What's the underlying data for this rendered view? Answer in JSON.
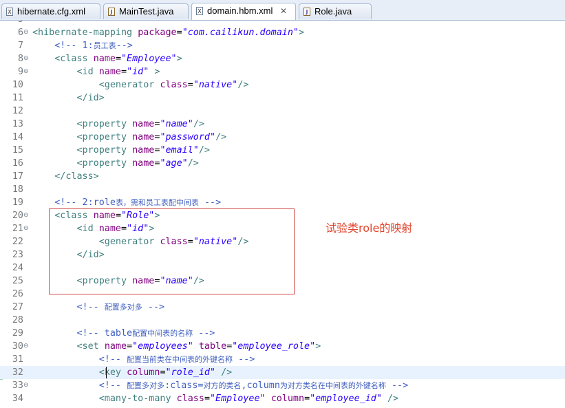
{
  "tabs": [
    {
      "label": "hibernate.cfg.xml",
      "icon": "xml-file-icon",
      "active": false
    },
    {
      "label": "MainTest.java",
      "icon": "java-file-icon",
      "active": false
    },
    {
      "label": "domain.hbm.xml",
      "icon": "xml-file-icon",
      "active": true,
      "close": "✕"
    },
    {
      "label": "Role.java",
      "icon": "java-file-icon",
      "active": false
    }
  ],
  "lines": [
    {
      "n": "5",
      "fold": "",
      "tokens": []
    },
    {
      "n": "6",
      "fold": "⊖",
      "tokens": [
        [
          "t",
          "<hibernate-mapping "
        ],
        [
          "a",
          "package"
        ],
        [
          "p",
          "="
        ],
        [
          "v",
          "\"com.cailikun.domain\""
        ],
        [
          "t",
          ">"
        ]
      ]
    },
    {
      "n": "7",
      "fold": "",
      "tokens": [
        [
          "p",
          "    "
        ],
        [
          "c",
          "<!-- 1:"
        ],
        [
          "cjk",
          "员工表"
        ],
        [
          "c",
          "-->"
        ]
      ]
    },
    {
      "n": "8",
      "fold": "⊖",
      "tokens": [
        [
          "p",
          "    "
        ],
        [
          "t",
          "<class "
        ],
        [
          "a",
          "name"
        ],
        [
          "p",
          "="
        ],
        [
          "v",
          "\"Employee\""
        ],
        [
          "t",
          ">"
        ]
      ]
    },
    {
      "n": "9",
      "fold": "⊖",
      "tokens": [
        [
          "p",
          "        "
        ],
        [
          "t",
          "<id "
        ],
        [
          "a",
          "name"
        ],
        [
          "p",
          "="
        ],
        [
          "v",
          "\"id\""
        ],
        [
          "t",
          " >"
        ]
      ]
    },
    {
      "n": "10",
      "fold": "",
      "tokens": [
        [
          "p",
          "            "
        ],
        [
          "t",
          "<generator "
        ],
        [
          "a",
          "class"
        ],
        [
          "p",
          "="
        ],
        [
          "v",
          "\"native\""
        ],
        [
          "t",
          "/>"
        ]
      ]
    },
    {
      "n": "11",
      "fold": "",
      "tokens": [
        [
          "p",
          "        "
        ],
        [
          "t",
          "</id>"
        ]
      ]
    },
    {
      "n": "12",
      "fold": "",
      "tokens": []
    },
    {
      "n": "13",
      "fold": "",
      "tokens": [
        [
          "p",
          "        "
        ],
        [
          "t",
          "<property "
        ],
        [
          "a",
          "name"
        ],
        [
          "p",
          "="
        ],
        [
          "v",
          "\"name\""
        ],
        [
          "t",
          "/>"
        ]
      ]
    },
    {
      "n": "14",
      "fold": "",
      "tokens": [
        [
          "p",
          "        "
        ],
        [
          "t",
          "<property "
        ],
        [
          "a",
          "name"
        ],
        [
          "p",
          "="
        ],
        [
          "v",
          "\"password\""
        ],
        [
          "t",
          "/>"
        ]
      ]
    },
    {
      "n": "15",
      "fold": "",
      "tokens": [
        [
          "p",
          "        "
        ],
        [
          "t",
          "<property "
        ],
        [
          "a",
          "name"
        ],
        [
          "p",
          "="
        ],
        [
          "v",
          "\"email\""
        ],
        [
          "t",
          "/>"
        ]
      ]
    },
    {
      "n": "16",
      "fold": "",
      "tokens": [
        [
          "p",
          "        "
        ],
        [
          "t",
          "<property "
        ],
        [
          "a",
          "name"
        ],
        [
          "p",
          "="
        ],
        [
          "v",
          "\"age\""
        ],
        [
          "t",
          "/>"
        ]
      ]
    },
    {
      "n": "17",
      "fold": "",
      "tokens": [
        [
          "p",
          "    "
        ],
        [
          "t",
          "</class>"
        ]
      ]
    },
    {
      "n": "18",
      "fold": "",
      "tokens": []
    },
    {
      "n": "19",
      "fold": "",
      "tokens": [
        [
          "p",
          "    "
        ],
        [
          "c",
          "<!-- 2:role"
        ],
        [
          "cjk",
          "表，需和员工表配中间表"
        ],
        [
          "c",
          " -->"
        ]
      ]
    },
    {
      "n": "20",
      "fold": "⊖",
      "tokens": [
        [
          "p",
          "    "
        ],
        [
          "t",
          "<class "
        ],
        [
          "a",
          "name"
        ],
        [
          "p",
          "="
        ],
        [
          "v",
          "\"Role\""
        ],
        [
          "t",
          ">"
        ]
      ]
    },
    {
      "n": "21",
      "fold": "⊖",
      "tokens": [
        [
          "p",
          "        "
        ],
        [
          "t",
          "<id "
        ],
        [
          "a",
          "name"
        ],
        [
          "p",
          "="
        ],
        [
          "v",
          "\"id\""
        ],
        [
          "t",
          ">"
        ]
      ]
    },
    {
      "n": "22",
      "fold": "",
      "tokens": [
        [
          "p",
          "            "
        ],
        [
          "t",
          "<generator "
        ],
        [
          "a",
          "class"
        ],
        [
          "p",
          "="
        ],
        [
          "v",
          "\"native\""
        ],
        [
          "t",
          "/>"
        ]
      ]
    },
    {
      "n": "23",
      "fold": "",
      "tokens": [
        [
          "p",
          "        "
        ],
        [
          "t",
          "</id>"
        ]
      ]
    },
    {
      "n": "24",
      "fold": "",
      "tokens": []
    },
    {
      "n": "25",
      "fold": "",
      "tokens": [
        [
          "p",
          "        "
        ],
        [
          "t",
          "<property "
        ],
        [
          "a",
          "name"
        ],
        [
          "p",
          "="
        ],
        [
          "v",
          "\"name\""
        ],
        [
          "t",
          "/>"
        ]
      ]
    },
    {
      "n": "26",
      "fold": "",
      "tokens": []
    },
    {
      "n": "27",
      "fold": "",
      "tokens": [
        [
          "p",
          "        "
        ],
        [
          "c",
          "<!-- "
        ],
        [
          "cjk",
          "配置多对多"
        ],
        [
          "c",
          " -->"
        ]
      ]
    },
    {
      "n": "28",
      "fold": "",
      "tokens": []
    },
    {
      "n": "29",
      "fold": "",
      "tokens": [
        [
          "p",
          "        "
        ],
        [
          "c",
          "<!-- table"
        ],
        [
          "cjk",
          "配置中间表的名称"
        ],
        [
          "c",
          " -->"
        ]
      ]
    },
    {
      "n": "30",
      "fold": "⊖",
      "tokens": [
        [
          "p",
          "        "
        ],
        [
          "t",
          "<set "
        ],
        [
          "a",
          "name"
        ],
        [
          "p",
          "="
        ],
        [
          "v",
          "\"employees\""
        ],
        [
          "p",
          " "
        ],
        [
          "a",
          "table"
        ],
        [
          "p",
          "="
        ],
        [
          "v",
          "\"employee_role\""
        ],
        [
          "t",
          ">"
        ]
      ]
    },
    {
      "n": "31",
      "fold": "",
      "tokens": [
        [
          "p",
          "            "
        ],
        [
          "c",
          "<!-- "
        ],
        [
          "cjk",
          "配置当前类在中间表的外键名称"
        ],
        [
          "c",
          " -->"
        ]
      ]
    },
    {
      "n": "32",
      "fold": "",
      "current": true,
      "tokens": [
        [
          "p",
          "            "
        ],
        [
          "t",
          "<key "
        ],
        [
          "a",
          "column"
        ],
        [
          "p",
          "="
        ],
        [
          "v",
          "\"role_id\""
        ],
        [
          "t",
          " />"
        ]
      ]
    },
    {
      "n": "33",
      "fold": "⊖",
      "tokens": [
        [
          "p",
          "            "
        ],
        [
          "c",
          "<!-- "
        ],
        [
          "cjk",
          "配置多对多"
        ],
        [
          "c",
          ":class="
        ],
        [
          "cjk",
          "对方的类名"
        ],
        [
          "c",
          ",column"
        ],
        [
          "cjk",
          "为对方类名在中间表的外键名称"
        ],
        [
          "c",
          " -->"
        ]
      ]
    },
    {
      "n": "34",
      "fold": "",
      "tokens": [
        [
          "p",
          "            "
        ],
        [
          "t",
          "<many-to-many "
        ],
        [
          "a",
          "class"
        ],
        [
          "p",
          "="
        ],
        [
          "v",
          "\"Employee\""
        ],
        [
          "p",
          " "
        ],
        [
          "a",
          "column"
        ],
        [
          "p",
          "="
        ],
        [
          "v",
          "\"employee_id\""
        ],
        [
          "t",
          " />"
        ]
      ]
    }
  ],
  "annotation": {
    "text": "试验类role的映射",
    "color": "#e0442c"
  },
  "colors": {
    "tag": "#3f7f7f",
    "attr": "#7f007f",
    "value": "#2a00ff",
    "comment": "#3f5fbf"
  }
}
